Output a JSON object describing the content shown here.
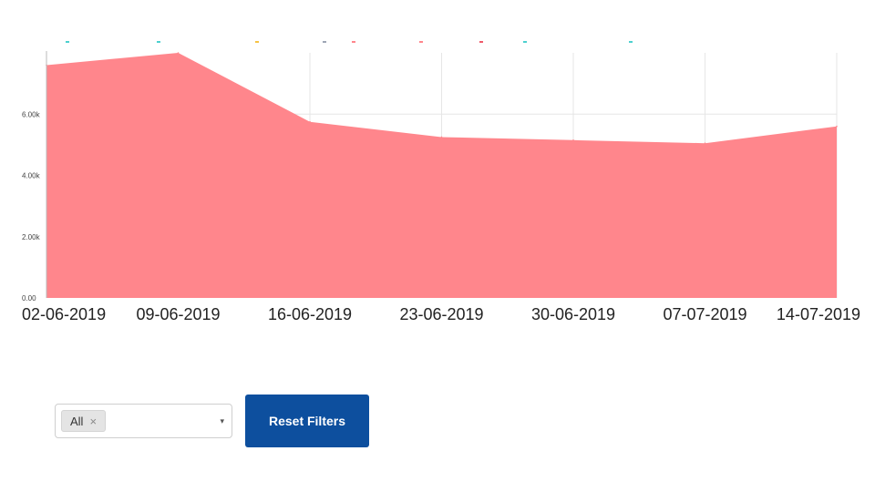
{
  "chart_data": {
    "type": "area",
    "x": [
      "02-06-2019",
      "09-06-2019",
      "16-06-2019",
      "23-06-2019",
      "30-06-2019",
      "07-07-2019",
      "14-07-2019"
    ],
    "series": [
      {
        "values": [
          7600,
          8000,
          5750,
          5250,
          5150,
          5050,
          5600
        ],
        "color": "#ff868c"
      }
    ],
    "yticks": [
      0,
      2000,
      4000,
      6000
    ],
    "ytick_labels": [
      "0.00",
      "2.00k",
      "4.00k",
      "6.00k"
    ],
    "ylim": [
      0,
      8000
    ],
    "grid": true,
    "legend": "top"
  },
  "legend_marker_colors": [
    "#4dd0cf",
    "#4dd0cf",
    "#f6c344",
    "#9ea6b5",
    "#ff868c",
    "#ff868c",
    "#ef5b6a",
    "#4dd0cf",
    "#4dd0cf"
  ],
  "filter": {
    "chip_label": "All",
    "chip_remove_icon": "×",
    "dropdown_icon": "▾"
  },
  "reset_button": {
    "label": "Reset Filters",
    "color": "#0d4f9e"
  }
}
